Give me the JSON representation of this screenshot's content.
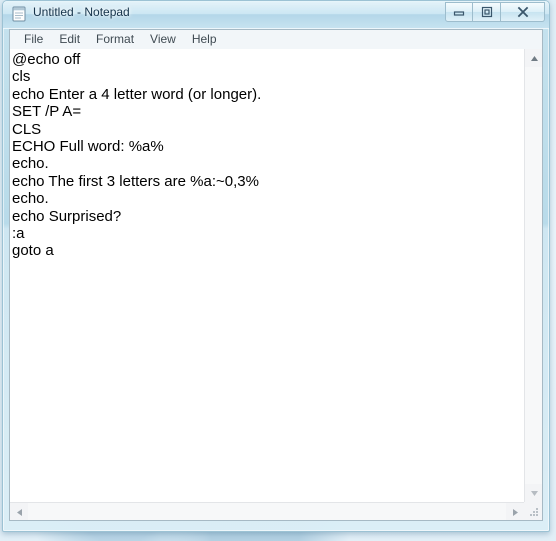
{
  "window": {
    "title": "Untitled - Notepad",
    "app_icon": "notepad-icon",
    "frame_color": "#b7dae9",
    "titlebar_text_color": "#16334a"
  },
  "window_buttons": [
    {
      "name": "minimize-button",
      "icon": "minimize-icon",
      "label": "Minimize"
    },
    {
      "name": "maximize-button",
      "icon": "restore-icon",
      "label": "Maximize"
    },
    {
      "name": "close-button",
      "icon": "close-icon",
      "label": "Close"
    }
  ],
  "menubar": {
    "items": [
      {
        "label": "File"
      },
      {
        "label": "Edit"
      },
      {
        "label": "Format"
      },
      {
        "label": "View"
      },
      {
        "label": "Help"
      }
    ]
  },
  "editor": {
    "background": "#ffffff",
    "text_color": "#000000",
    "lines": [
      "@echo off",
      "cls",
      "echo Enter a 4 letter word (or longer).",
      "SET /P A=",
      "CLS",
      "ECHO Full word: %a%",
      "echo.",
      "echo The first 3 letters are %a:~0,3%",
      "echo.",
      "echo Surprised?",
      ":a",
      "goto a"
    ]
  },
  "scrollbars": {
    "vertical": {
      "up_icon": "scroll-up-arrow-icon",
      "down_icon": "scroll-down-arrow-icon"
    },
    "horizontal": {
      "left_icon": "scroll-left-arrow-icon",
      "right_icon": "scroll-right-arrow-icon"
    },
    "resize_grip_icon": "resize-grip-icon"
  }
}
